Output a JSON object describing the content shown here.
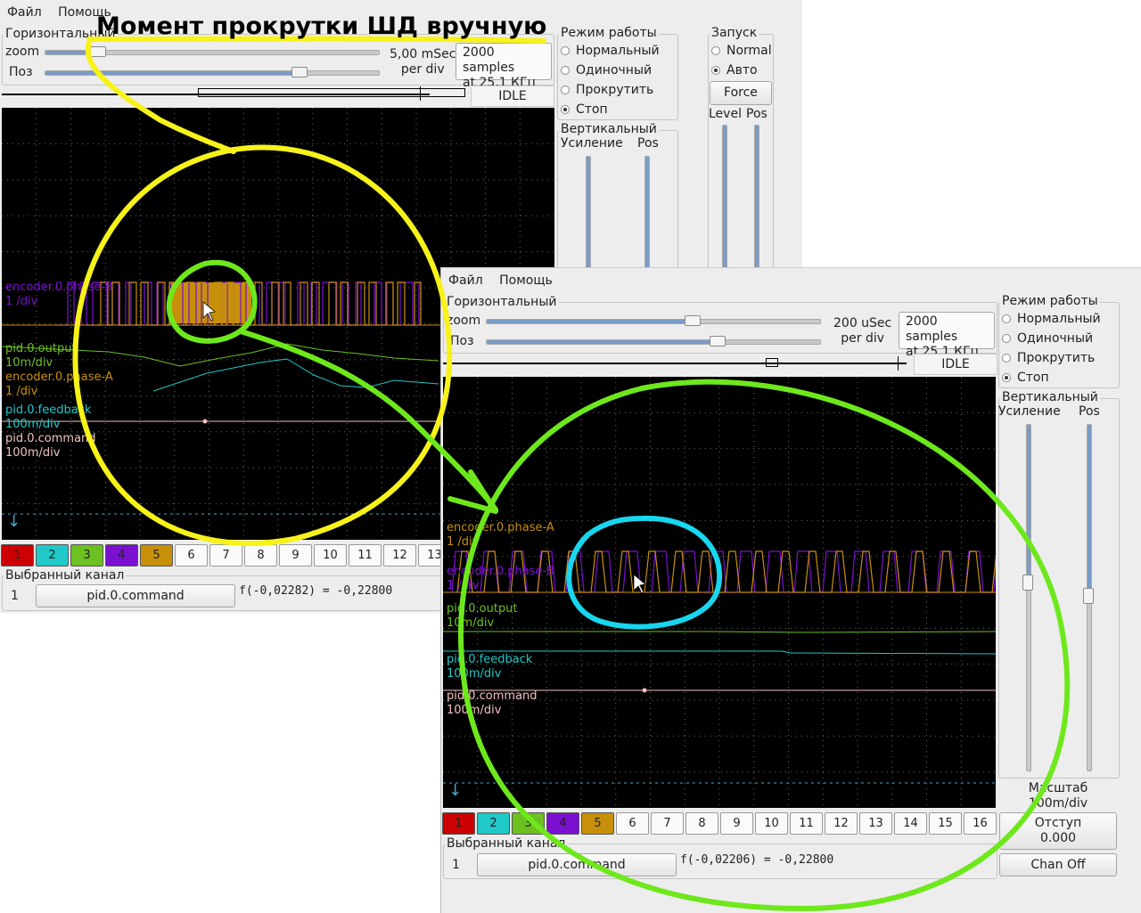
{
  "annotation": {
    "text": "Момент прокрутки ШД вручную"
  },
  "colors": {
    "yellow": "#f7f21a",
    "green": "#6ee81c",
    "cyan": "#18d6ee",
    "ch1": "#cc0000",
    "ch2": "#20c8c8",
    "ch3": "#6cc020",
    "ch4": "#7b10d0",
    "ch5": "#c8900a"
  },
  "window1": {
    "menu": {
      "file": "Файл",
      "help": "Помощь"
    },
    "horizontal": {
      "title": "Горизонтальный",
      "zoom_label": "zoom",
      "pos_label": "Поз",
      "zoom_value": "5,00 mSec",
      "per_div": "per div",
      "samples": "2000 samples",
      "rate": "at 25,1 КГц",
      "status": "IDLE"
    },
    "mode": {
      "title": "Режим работы",
      "normal": "Нормальный",
      "single": "Одиночный",
      "roll": "Прокрутить",
      "stop": "Стоп"
    },
    "trigger": {
      "title": "Запуск",
      "normal": "Normal",
      "auto": "Авто",
      "force": "Force",
      "level": "Level",
      "pos": "Pos"
    },
    "vertical": {
      "title": "Вертикальный",
      "gain": "Усиление",
      "pos": "Pos"
    },
    "channels": [
      {
        "name": "encoder.0.phase-B",
        "scale": "1 /div",
        "color": "#7b10d0"
      },
      {
        "name": "pid.0.output",
        "scale": "10m/div",
        "color": "#6cc020"
      },
      {
        "name": "encoder.0.phase-A",
        "scale": "1 /div",
        "color": "#c8900a"
      },
      {
        "name": "pid.0.feedback",
        "scale": "100m/div",
        "color": "#20c8c8"
      },
      {
        "name": "pid.0.command",
        "scale": "100m/div",
        "color": "#f0c0c0"
      }
    ],
    "channel_buttons": [
      "1",
      "2",
      "3",
      "4",
      "5",
      "6",
      "7",
      "8",
      "9",
      "10",
      "11",
      "12",
      "13"
    ],
    "selected": {
      "title": "Выбранный канал",
      "index": "1",
      "name": "pid.0.command",
      "formula": "f(-0,02282) = -0,22800"
    }
  },
  "window2": {
    "menu": {
      "file": "Файл",
      "help": "Помощь"
    },
    "horizontal": {
      "title": "Горизонтальный",
      "zoom_label": "zoom",
      "pos_label": "Поз",
      "zoom_value": "200 uSec",
      "per_div": "per div",
      "samples": "2000 samples",
      "rate": "at 25,1 КГц",
      "status": "IDLE"
    },
    "mode": {
      "title": "Режим работы",
      "normal": "Нормальный",
      "single": "Одиночный",
      "roll": "Прокрутить",
      "stop": "Стоп"
    },
    "vertical": {
      "title": "Вертикальный",
      "gain": "Усиление",
      "pos": "Pos",
      "scale_title": "Масштаб",
      "scale_value": "100m/div",
      "offset_title": "Отступ",
      "offset_value": "0.000",
      "chan_off": "Chan Off"
    },
    "channels": [
      {
        "name": "encoder.0.phase-A",
        "scale": "1 /div",
        "color": "#c8900a"
      },
      {
        "name": "encoder.0.phase-B",
        "scale": "1 /div",
        "color": "#7b10d0"
      },
      {
        "name": "pid.0.output",
        "scale": "10m/div",
        "color": "#6cc020"
      },
      {
        "name": "pid.0.feedback",
        "scale": "100m/div",
        "color": "#20c8c8"
      },
      {
        "name": "pid.0.command",
        "scale": "100m/div",
        "color": "#f0c0c0"
      }
    ],
    "channel_buttons": [
      "1",
      "2",
      "3",
      "4",
      "5",
      "6",
      "7",
      "8",
      "9",
      "10",
      "11",
      "12",
      "13",
      "14",
      "15",
      "16"
    ],
    "selected": {
      "title": "Выбранный канал",
      "index": "1",
      "name": "pid.0.command",
      "formula": "f(-0,02206) = -0,22800"
    }
  }
}
